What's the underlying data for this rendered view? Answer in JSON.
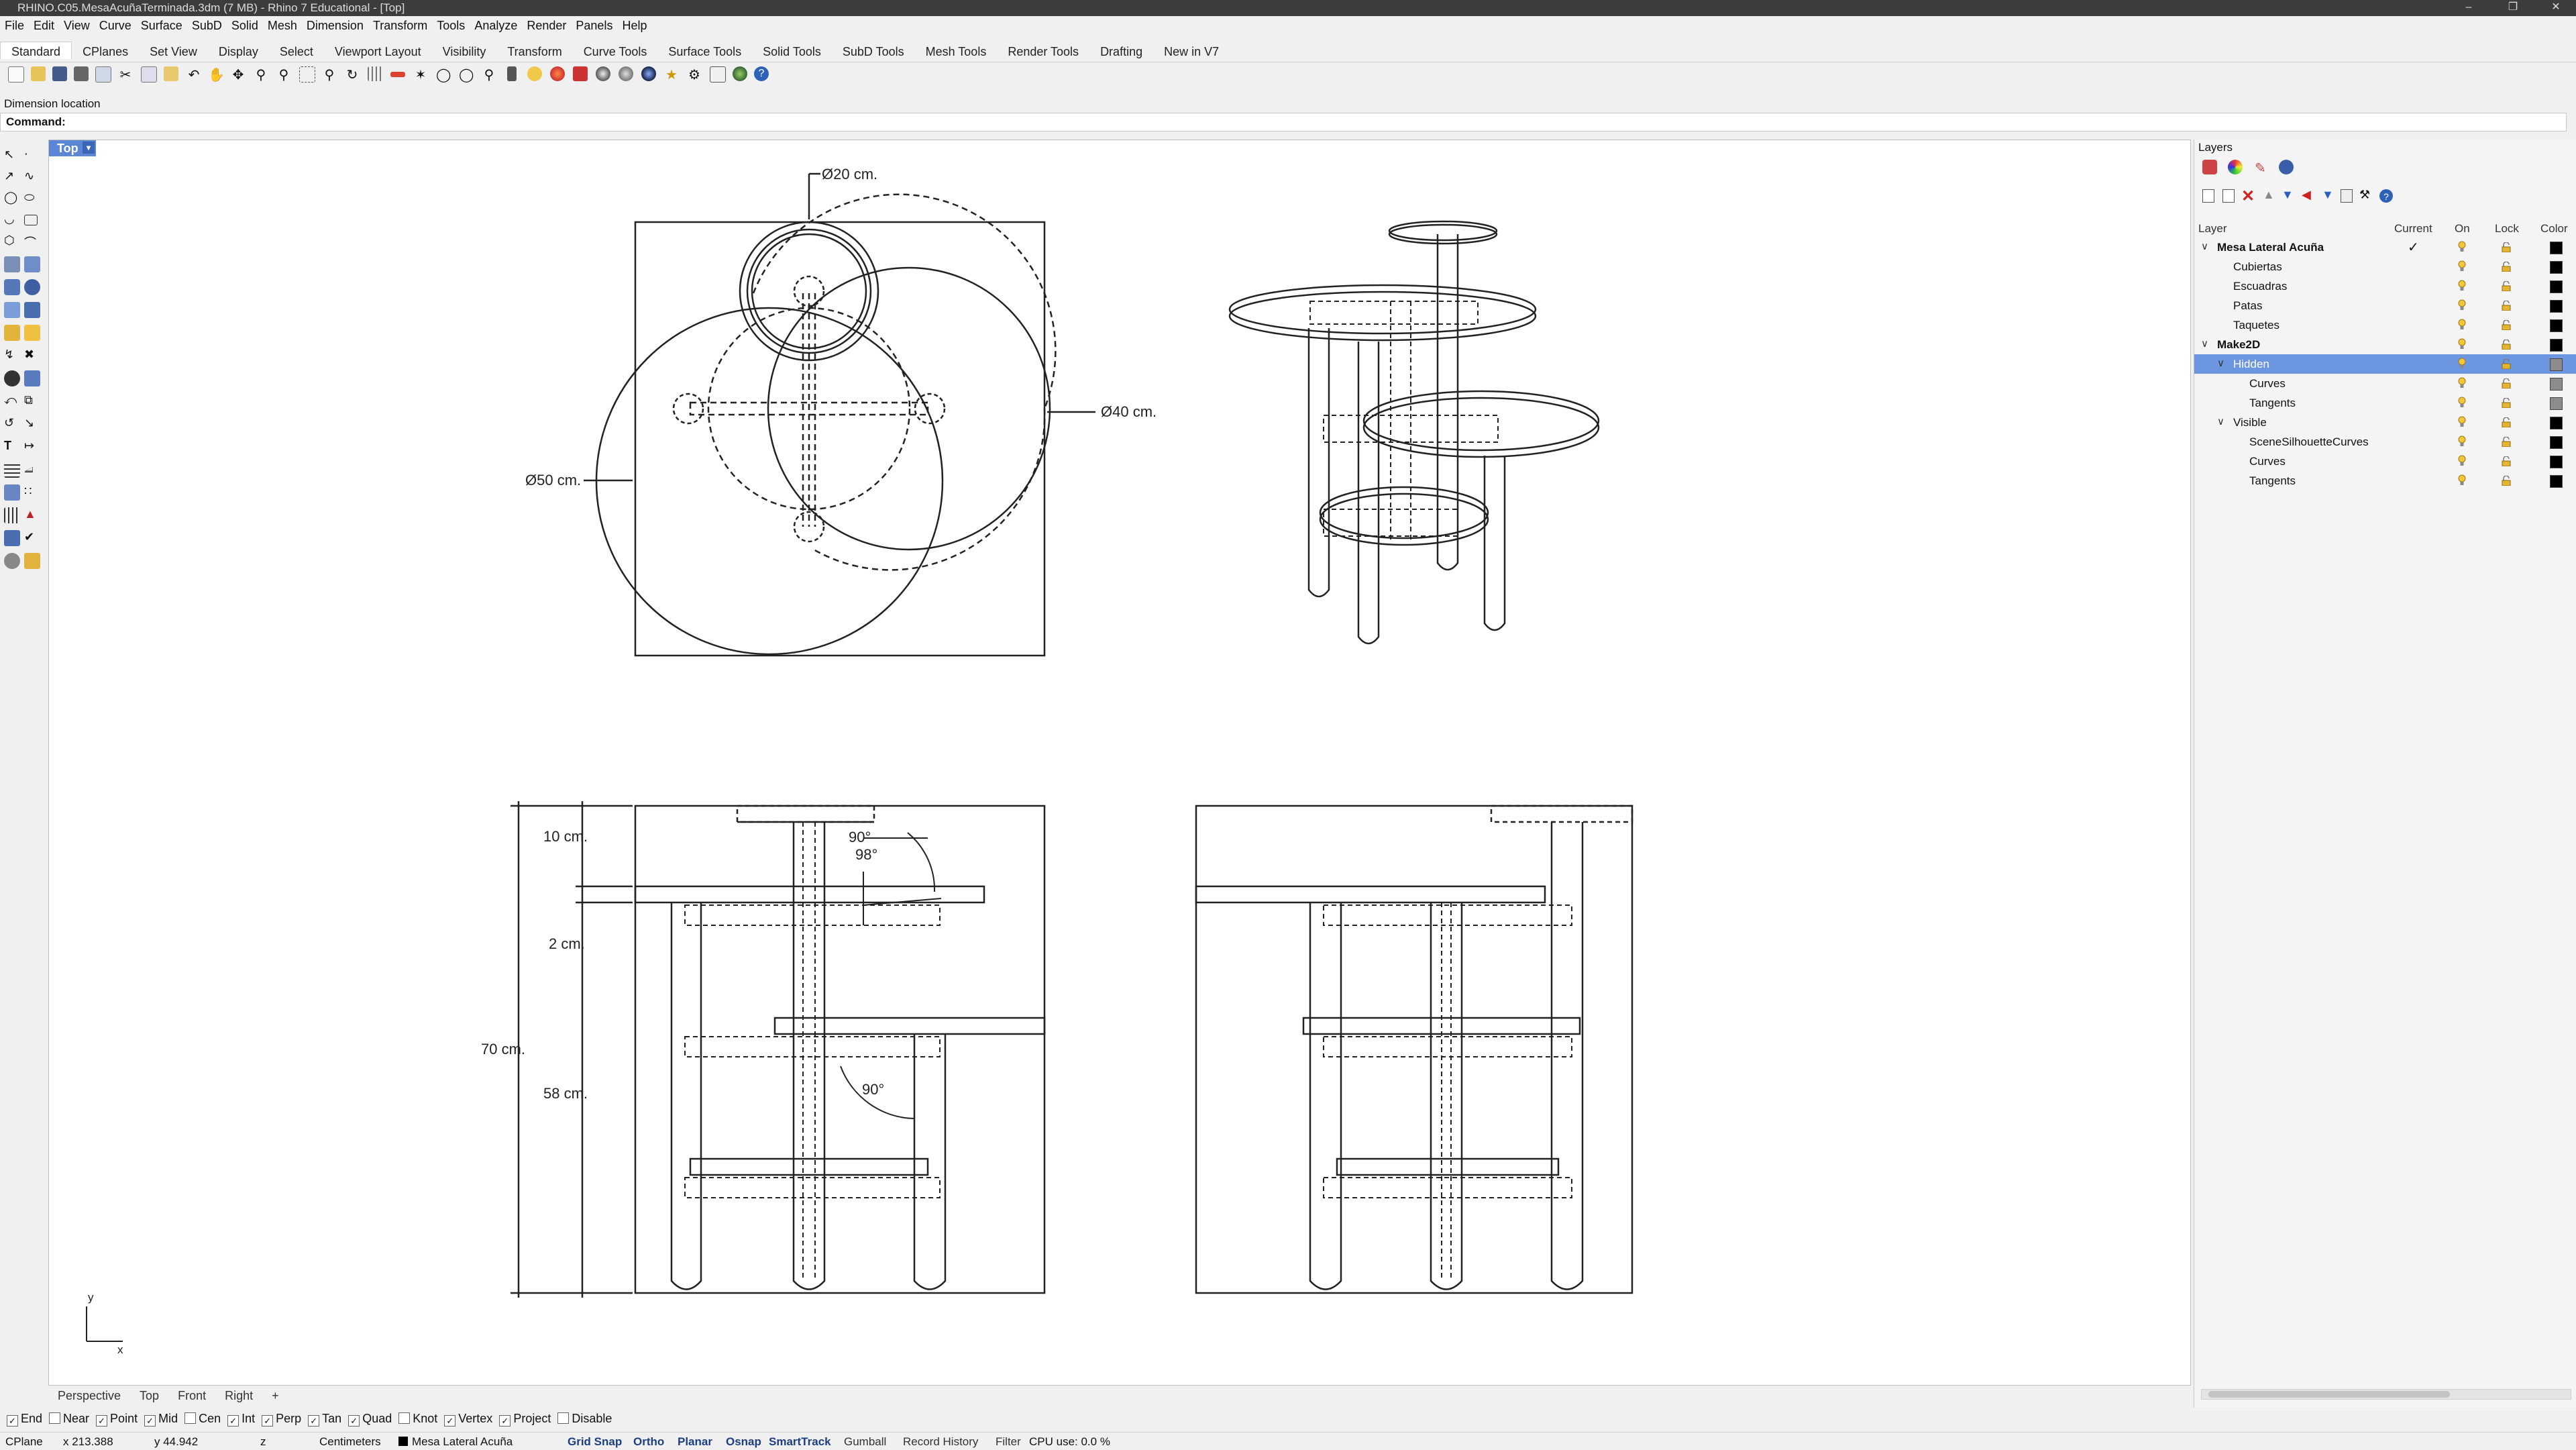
{
  "window": {
    "title": "RHINO.C05.MesaAcuñaTerminada.3dm (7 MB) - Rhino 7 Educational - [Top]"
  },
  "menu": [
    "File",
    "Edit",
    "View",
    "Curve",
    "Surface",
    "SubD",
    "Solid",
    "Mesh",
    "Dimension",
    "Transform",
    "Tools",
    "Analyze",
    "Render",
    "Panels",
    "Help"
  ],
  "toolbar_tabs": [
    "Standard",
    "CPlanes",
    "Set View",
    "Display",
    "Select",
    "Viewport Layout",
    "Visibility",
    "Transform",
    "Curve Tools",
    "Surface Tools",
    "Solid Tools",
    "SubD Tools",
    "Mesh Tools",
    "Render Tools",
    "Drafting",
    "New in V7"
  ],
  "command": {
    "history": "Dimension location",
    "prompt": "Command:"
  },
  "viewport": {
    "active_tab": "Top",
    "labels": {
      "d20": "Ø20 cm.",
      "d40": "Ø40 cm.",
      "d50": "Ø50 cm.",
      "h10": "10 cm.",
      "h2": "2 cm.",
      "h70": "70 cm.",
      "h58": "58 cm.",
      "a90a": "90°",
      "a98": "98°",
      "a90b": "90°",
      "axis_y": "y",
      "axis_x": "x"
    }
  },
  "view_tabs": [
    "Perspective",
    "Top",
    "Front",
    "Right"
  ],
  "osnaps": [
    {
      "label": "End",
      "on": true
    },
    {
      "label": "Near",
      "on": false
    },
    {
      "label": "Point",
      "on": true
    },
    {
      "label": "Mid",
      "on": true
    },
    {
      "label": "Cen",
      "on": false
    },
    {
      "label": "Int",
      "on": true
    },
    {
      "label": "Perp",
      "on": true
    },
    {
      "label": "Tan",
      "on": true
    },
    {
      "label": "Quad",
      "on": true
    },
    {
      "label": "Knot",
      "on": false
    },
    {
      "label": "Vertex",
      "on": true
    },
    {
      "label": "Project",
      "on": true
    },
    {
      "label": "Disable",
      "on": false
    }
  ],
  "status": {
    "cplane": "CPlane",
    "x": "x 213.388",
    "y": "y 44.942",
    "z": "z",
    "units": "Centimeters",
    "layer": "Mesa Lateral Acuña",
    "panes": [
      {
        "label": "Grid Snap",
        "on": true
      },
      {
        "label": "Ortho",
        "on": true
      },
      {
        "label": "Planar",
        "on": true
      },
      {
        "label": "Osnap",
        "on": true
      },
      {
        "label": "SmartTrack",
        "on": true
      },
      {
        "label": "Gumball",
        "on": false
      },
      {
        "label": "Record History",
        "on": false
      },
      {
        "label": "Filter",
        "on": false
      }
    ],
    "cpu": "CPU use: 0.0 %"
  },
  "layers_panel": {
    "title": "Layers",
    "headers": {
      "layer": "Layer",
      "current": "Current",
      "on": "On",
      "lock": "Lock",
      "color": "Color"
    },
    "rows": [
      {
        "name": "Mesa Lateral Acuña",
        "level": 0,
        "expand": "v",
        "current": true,
        "color": "#000000",
        "selected": false
      },
      {
        "name": "Cubiertas",
        "level": 1,
        "expand": "",
        "current": false,
        "color": "#000000",
        "selected": false
      },
      {
        "name": "Escuadras",
        "level": 1,
        "expand": "",
        "current": false,
        "color": "#000000",
        "selected": false
      },
      {
        "name": "Patas",
        "level": 1,
        "expand": "",
        "current": false,
        "color": "#000000",
        "selected": false
      },
      {
        "name": "Taquetes",
        "level": 1,
        "expand": "",
        "current": false,
        "color": "#000000",
        "selected": false
      },
      {
        "name": "Make2D",
        "level": 0,
        "expand": "v",
        "current": false,
        "color": "#000000",
        "selected": false
      },
      {
        "name": "Hidden",
        "level": 1,
        "expand": "v",
        "current": false,
        "color": "#8c8c8c",
        "selected": true
      },
      {
        "name": "Curves",
        "level": 2,
        "expand": "",
        "current": false,
        "color": "#8c8c8c",
        "selected": false
      },
      {
        "name": "Tangents",
        "level": 2,
        "expand": "",
        "current": false,
        "color": "#8c8c8c",
        "selected": false
      },
      {
        "name": "Visible",
        "level": 1,
        "expand": "v",
        "current": false,
        "color": "#000000",
        "selected": false
      },
      {
        "name": "SceneSilhouetteCurves",
        "level": 2,
        "expand": "",
        "current": false,
        "color": "#000000",
        "selected": false
      },
      {
        "name": "Curves",
        "level": 2,
        "expand": "",
        "current": false,
        "color": "#000000",
        "selected": false
      },
      {
        "name": "Tangents",
        "level": 2,
        "expand": "",
        "current": false,
        "color": "#000000",
        "selected": false
      }
    ]
  }
}
